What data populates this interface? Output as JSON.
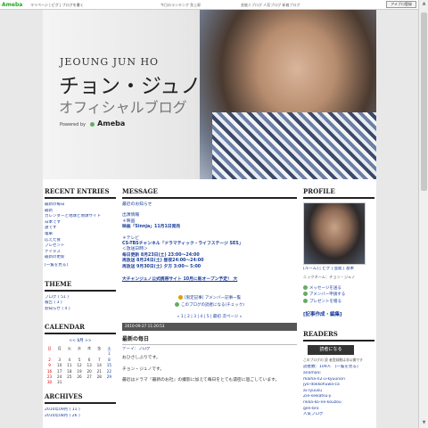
{
  "topbar": {
    "logo": "Ameba",
    "nav": "マイページ | ピグ | ブログを書く",
    "mid": "今日のランキング 急上昇",
    "right": "芸能人ブログ  人気ブログ  新着ブログ",
    "button": "アメブロ登録"
  },
  "header": {
    "name_en": "JEOUNG JUN HO",
    "name_jp": "チョン・ジュノ",
    "subtitle": "オフィシャルブログ",
    "powered_prefix": "Powered by",
    "powered_brand": "Ameba"
  },
  "left": {
    "recent_title": "RECENT ENTRIES",
    "recent": [
      "最新の毎日",
      "最新",
      "カレンダーと地球と地球サイト",
      "日本です",
      "遠です",
      "電車",
      "応えた食",
      "プレゼント",
      "ナイタス",
      "最新の更新"
    ],
    "recent_more": "[一覧を見る]",
    "theme_title": "THEME",
    "themes": [
      "ブログ ( 51 )",
      "報告 ( 3 )",
      "お知らせ ( 4 )"
    ],
    "calendar_title": "CALENDAR",
    "calendar_header": "<< 8月 >>",
    "weekdays": [
      "日",
      "月",
      "火",
      "水",
      "木",
      "金",
      "土"
    ],
    "weeks": [
      [
        "",
        "",
        "",
        "",
        "",
        "",
        "1"
      ],
      [
        "2",
        "3",
        "4",
        "5",
        "6",
        "7",
        "8"
      ],
      [
        "9",
        "10",
        "11",
        "12",
        "13",
        "14",
        "15"
      ],
      [
        "16",
        "17",
        "18",
        "19",
        "20",
        "21",
        "22"
      ],
      [
        "23",
        "24",
        "25",
        "26",
        "27",
        "28",
        "29"
      ],
      [
        "30",
        "31",
        "",
        "",
        "",
        "",
        ""
      ]
    ],
    "archives_title": "ARCHIVES",
    "archives": [
      "2010年09月 ( 11 )",
      "2010年08月 ( 26 )"
    ]
  },
  "main": {
    "title": "MESSAGE",
    "lines": [
      "最近のお知らせ",
      "",
      "出演情報",
      "＊映画",
      "映画「Sinnja」11月1日発売",
      "",
      "＊テレビ",
      "CS-TBSチャンネル「ドラマティック・ライフステージ SES」",
      "＜放送日時＞",
      "毎日更新 8月23日(土) 23:00〜24:00",
      "再放送 8月24日(土) 昼夜24:00〜24:00",
      "再放送 9月30日(土) 夕方 3:00〜 5:00"
    ],
    "promo": "大チャンジュノ公式携帯サイト 10月に新オープン予定！ 大",
    "member_link": "[限定記事] アメンバー記事一覧",
    "blog_link": "このブログの読者になる(チェック)",
    "pager": "« 1 | 2 | 3 | 4 | 5 | 最初  次ページ »",
    "entry_date": "2010-09-27 11:20:53",
    "entry_title": "最新の毎日",
    "entry_theme": "テーマ：ブログ",
    "entry_lines": [
      "おひさしぶりです。",
      "",
      "チョン・ジュノです。",
      "",
      "最近はドラマ『最新のお社』の撮影に加えて毎日をとても濃密に過ごしています。"
    ]
  },
  "right": {
    "profile_title": "PROFILE",
    "profile_caption": "[ルーム] | ピグ | 芸能 | 基本",
    "profile_sub": "ニックネーム：チョン・ジュノ",
    "actions": [
      "メッセージを送る",
      "アメンバー申請する",
      "プレゼントを贈る"
    ],
    "recording": "[記事作成・編集]",
    "readers_title": "READERS",
    "readers_button": "読者になる",
    "readers_note": "このブログの 読 者登録数は非公開です",
    "readers_count": "読者数：109人　[一覧を見る]",
    "readers": [
      "anomani",
      "maiha-n2-u-kyuunori",
      "jyo-dokkohuwa-ca",
      "ai-ryuusu",
      "Zie-seikatsu-ji",
      "rikka-ko-ne-kouzou",
      "gen-bro",
      "人気ブログ"
    ]
  }
}
